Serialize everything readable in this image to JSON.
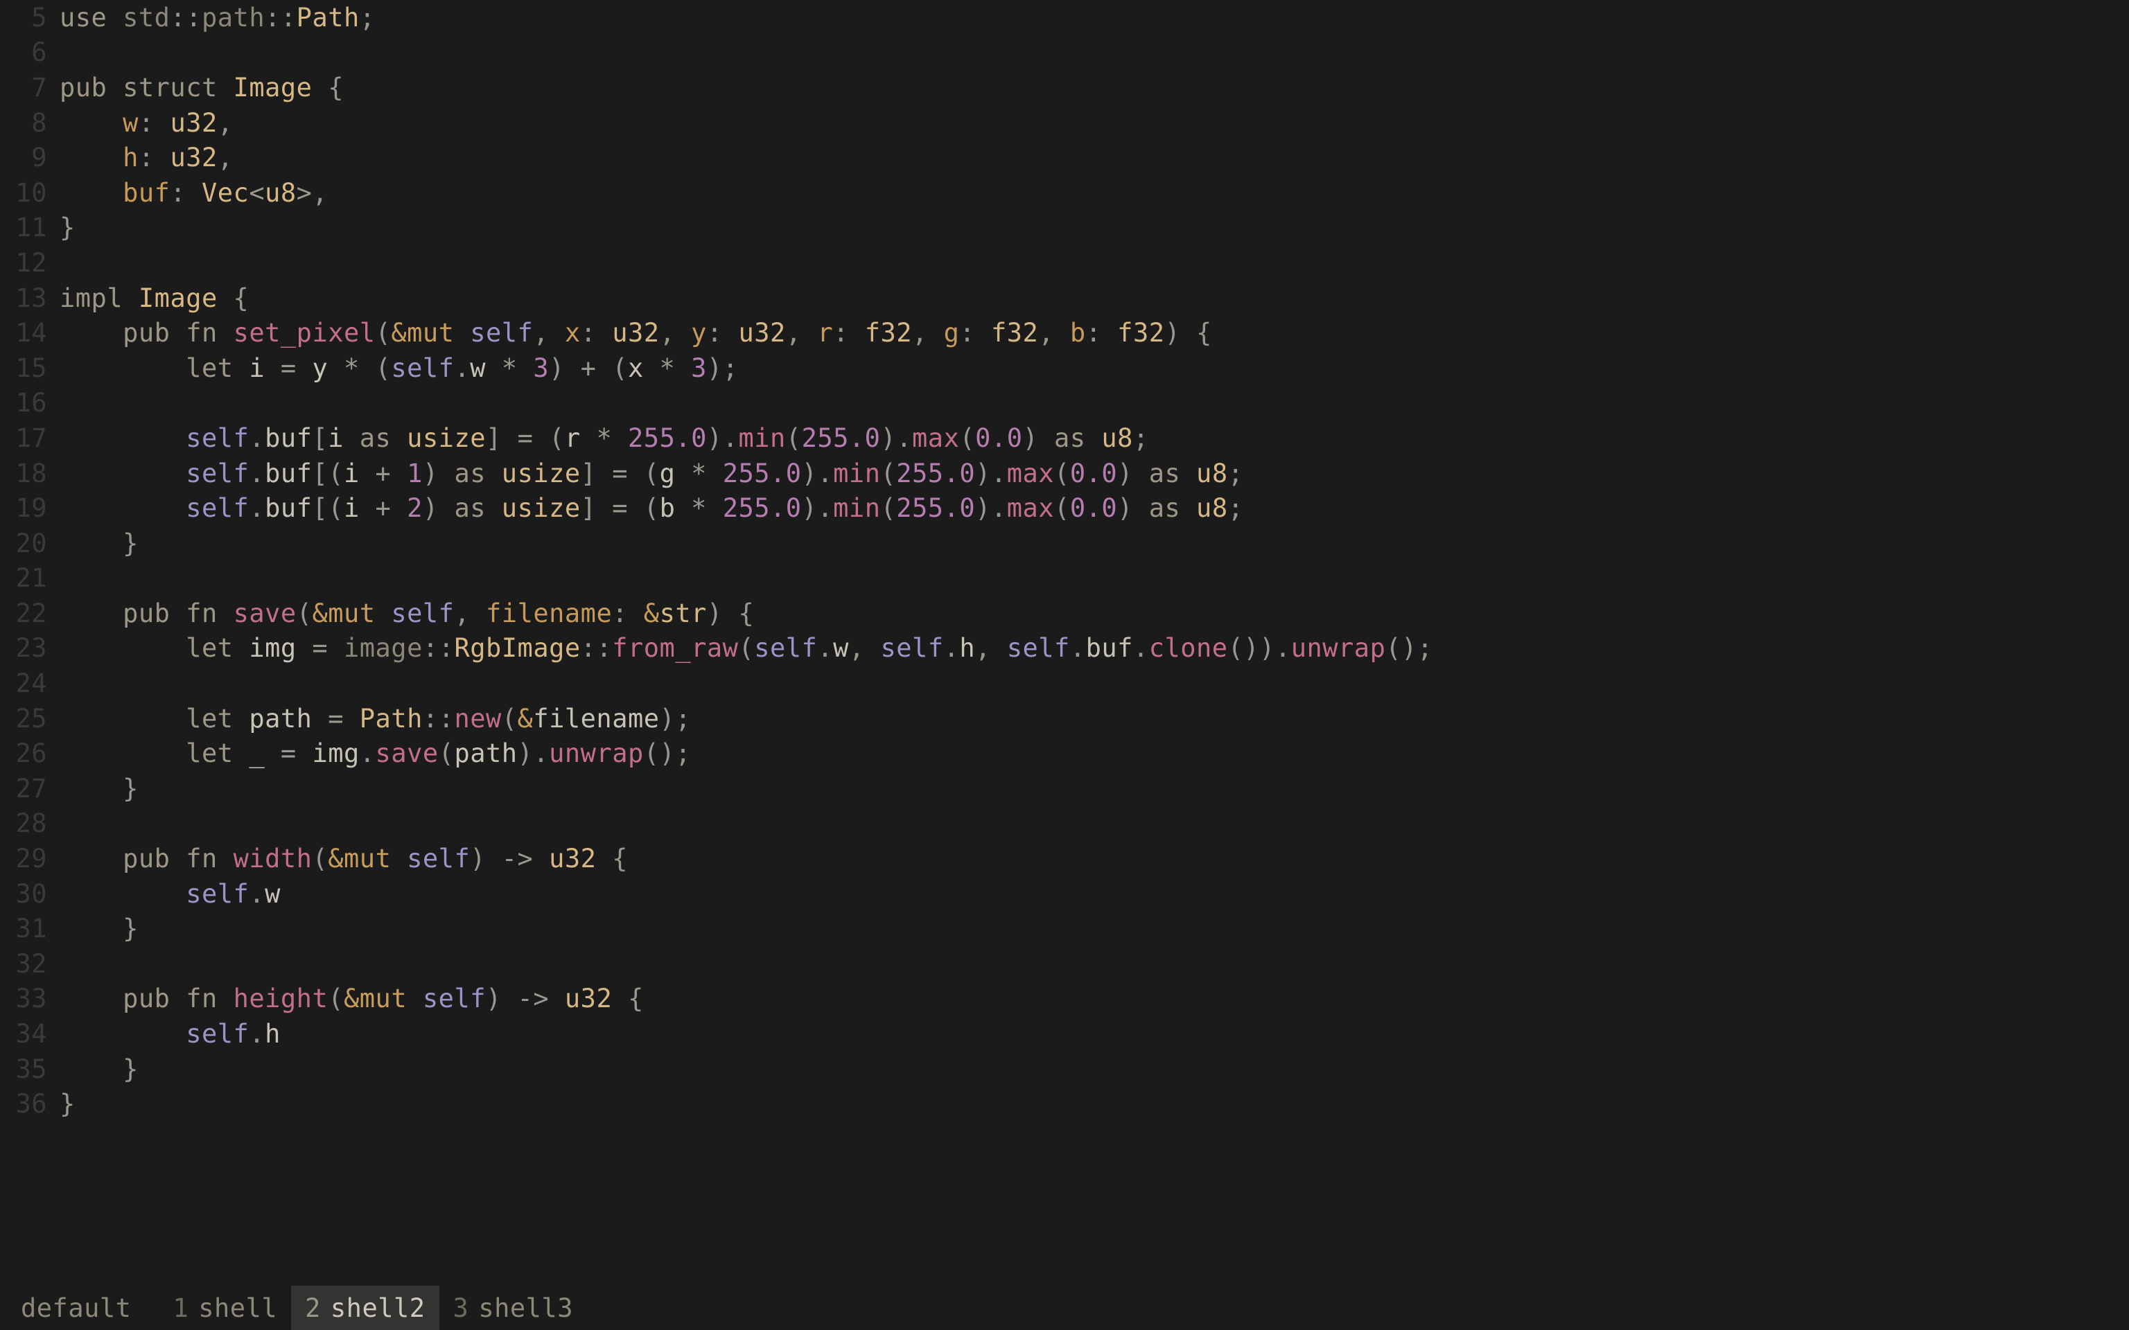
{
  "status": {
    "session": "default",
    "tabs": [
      {
        "index": "1",
        "name": "shell",
        "active": false
      },
      {
        "index": "2",
        "name": "shell2",
        "active": true
      },
      {
        "index": "3",
        "name": "shell3",
        "active": false
      }
    ]
  },
  "lines": [
    {
      "n": 5,
      "t": [
        [
          "kw",
          "use"
        ],
        [
          "punc",
          " "
        ],
        [
          "ns",
          "std"
        ],
        [
          "punc",
          "::"
        ],
        [
          "ns",
          "path"
        ],
        [
          "punc",
          "::"
        ],
        [
          "ty",
          "Path"
        ],
        [
          "punc",
          ";"
        ]
      ]
    },
    {
      "n": 6,
      "t": []
    },
    {
      "n": 7,
      "t": [
        [
          "kw",
          "pub"
        ],
        [
          "punc",
          " "
        ],
        [
          "kw",
          "struct"
        ],
        [
          "punc",
          " "
        ],
        [
          "ty",
          "Image"
        ],
        [
          "punc",
          " {"
        ]
      ]
    },
    {
      "n": 8,
      "t": [
        [
          "punc",
          "    "
        ],
        [
          "decl",
          "w"
        ],
        [
          "punc",
          ": "
        ],
        [
          "ty",
          "u32"
        ],
        [
          "punc",
          ","
        ]
      ]
    },
    {
      "n": 9,
      "t": [
        [
          "punc",
          "    "
        ],
        [
          "decl",
          "h"
        ],
        [
          "punc",
          ": "
        ],
        [
          "ty",
          "u32"
        ],
        [
          "punc",
          ","
        ]
      ]
    },
    {
      "n": 10,
      "t": [
        [
          "punc",
          "    "
        ],
        [
          "decl",
          "buf"
        ],
        [
          "punc",
          ": "
        ],
        [
          "ty",
          "Vec"
        ],
        [
          "punc",
          "<"
        ],
        [
          "ty",
          "u8"
        ],
        [
          "punc",
          ">,"
        ]
      ]
    },
    {
      "n": 11,
      "t": [
        [
          "punc",
          "}"
        ]
      ]
    },
    {
      "n": 12,
      "t": []
    },
    {
      "n": 13,
      "t": [
        [
          "kw",
          "impl"
        ],
        [
          "punc",
          " "
        ],
        [
          "ty",
          "Image"
        ],
        [
          "punc",
          " {"
        ]
      ]
    },
    {
      "n": 14,
      "t": [
        [
          "punc",
          "    "
        ],
        [
          "kw",
          "pub"
        ],
        [
          "punc",
          " "
        ],
        [
          "kw",
          "fn"
        ],
        [
          "punc",
          " "
        ],
        [
          "func",
          "set_pixel"
        ],
        [
          "punc",
          "("
        ],
        [
          "amp",
          "&"
        ],
        [
          "mutw",
          "mut"
        ],
        [
          "punc",
          " "
        ],
        [
          "mut",
          "self"
        ],
        [
          "punc",
          ", "
        ],
        [
          "decl",
          "x"
        ],
        [
          "punc",
          ": "
        ],
        [
          "ty",
          "u32"
        ],
        [
          "punc",
          ", "
        ],
        [
          "decl",
          "y"
        ],
        [
          "punc",
          ": "
        ],
        [
          "ty",
          "u32"
        ],
        [
          "punc",
          ", "
        ],
        [
          "decl",
          "r"
        ],
        [
          "punc",
          ": "
        ],
        [
          "ty",
          "f32"
        ],
        [
          "punc",
          ", "
        ],
        [
          "decl",
          "g"
        ],
        [
          "punc",
          ": "
        ],
        [
          "ty",
          "f32"
        ],
        [
          "punc",
          ", "
        ],
        [
          "decl",
          "b"
        ],
        [
          "punc",
          ": "
        ],
        [
          "ty",
          "f32"
        ],
        [
          "punc",
          ") {"
        ]
      ]
    },
    {
      "n": 15,
      "t": [
        [
          "punc",
          "        "
        ],
        [
          "kw",
          "let"
        ],
        [
          "punc",
          " "
        ],
        [
          "var",
          "i"
        ],
        [
          "punc",
          " = "
        ],
        [
          "var",
          "y"
        ],
        [
          "punc",
          " * ("
        ],
        [
          "mut",
          "self"
        ],
        [
          "punc",
          "."
        ],
        [
          "var",
          "w"
        ],
        [
          "punc",
          " * "
        ],
        [
          "num",
          "3"
        ],
        [
          "punc",
          ") + ("
        ],
        [
          "var",
          "x"
        ],
        [
          "punc",
          " * "
        ],
        [
          "num",
          "3"
        ],
        [
          "punc",
          ");"
        ]
      ]
    },
    {
      "n": 16,
      "t": []
    },
    {
      "n": 17,
      "t": [
        [
          "punc",
          "        "
        ],
        [
          "mut",
          "self"
        ],
        [
          "punc",
          "."
        ],
        [
          "var",
          "buf"
        ],
        [
          "punc",
          "["
        ],
        [
          "var",
          "i"
        ],
        [
          "punc",
          " "
        ],
        [
          "kw",
          "as"
        ],
        [
          "punc",
          " "
        ],
        [
          "ty",
          "usize"
        ],
        [
          "punc",
          "] = ("
        ],
        [
          "var",
          "r"
        ],
        [
          "punc",
          " * "
        ],
        [
          "num",
          "255.0"
        ],
        [
          "punc",
          ")."
        ],
        [
          "func",
          "min"
        ],
        [
          "punc",
          "("
        ],
        [
          "num",
          "255.0"
        ],
        [
          "punc",
          ")."
        ],
        [
          "func",
          "max"
        ],
        [
          "punc",
          "("
        ],
        [
          "num",
          "0.0"
        ],
        [
          "punc",
          ") "
        ],
        [
          "kw",
          "as"
        ],
        [
          "punc",
          " "
        ],
        [
          "ty",
          "u8"
        ],
        [
          "punc",
          ";"
        ]
      ]
    },
    {
      "n": 18,
      "t": [
        [
          "punc",
          "        "
        ],
        [
          "mut",
          "self"
        ],
        [
          "punc",
          "."
        ],
        [
          "var",
          "buf"
        ],
        [
          "punc",
          "[("
        ],
        [
          "var",
          "i"
        ],
        [
          "punc",
          " + "
        ],
        [
          "num",
          "1"
        ],
        [
          "punc",
          ") "
        ],
        [
          "kw",
          "as"
        ],
        [
          "punc",
          " "
        ],
        [
          "ty",
          "usize"
        ],
        [
          "punc",
          "] = ("
        ],
        [
          "var",
          "g"
        ],
        [
          "punc",
          " * "
        ],
        [
          "num",
          "255.0"
        ],
        [
          "punc",
          ")."
        ],
        [
          "func",
          "min"
        ],
        [
          "punc",
          "("
        ],
        [
          "num",
          "255.0"
        ],
        [
          "punc",
          ")."
        ],
        [
          "func",
          "max"
        ],
        [
          "punc",
          "("
        ],
        [
          "num",
          "0.0"
        ],
        [
          "punc",
          ") "
        ],
        [
          "kw",
          "as"
        ],
        [
          "punc",
          " "
        ],
        [
          "ty",
          "u8"
        ],
        [
          "punc",
          ";"
        ]
      ]
    },
    {
      "n": 19,
      "t": [
        [
          "punc",
          "        "
        ],
        [
          "mut",
          "self"
        ],
        [
          "punc",
          "."
        ],
        [
          "var",
          "buf"
        ],
        [
          "punc",
          "[("
        ],
        [
          "var",
          "i"
        ],
        [
          "punc",
          " + "
        ],
        [
          "num",
          "2"
        ],
        [
          "punc",
          ") "
        ],
        [
          "kw",
          "as"
        ],
        [
          "punc",
          " "
        ],
        [
          "ty",
          "usize"
        ],
        [
          "punc",
          "] = ("
        ],
        [
          "var",
          "b"
        ],
        [
          "punc",
          " * "
        ],
        [
          "num",
          "255.0"
        ],
        [
          "punc",
          ")."
        ],
        [
          "func",
          "min"
        ],
        [
          "punc",
          "("
        ],
        [
          "num",
          "255.0"
        ],
        [
          "punc",
          ")."
        ],
        [
          "func",
          "max"
        ],
        [
          "punc",
          "("
        ],
        [
          "num",
          "0.0"
        ],
        [
          "punc",
          ") "
        ],
        [
          "kw",
          "as"
        ],
        [
          "punc",
          " "
        ],
        [
          "ty",
          "u8"
        ],
        [
          "punc",
          ";"
        ]
      ]
    },
    {
      "n": 20,
      "t": [
        [
          "punc",
          "    }"
        ]
      ]
    },
    {
      "n": 21,
      "t": []
    },
    {
      "n": 22,
      "t": [
        [
          "punc",
          "    "
        ],
        [
          "kw",
          "pub"
        ],
        [
          "punc",
          " "
        ],
        [
          "kw",
          "fn"
        ],
        [
          "punc",
          " "
        ],
        [
          "func",
          "save"
        ],
        [
          "punc",
          "("
        ],
        [
          "amp",
          "&"
        ],
        [
          "mutw",
          "mut"
        ],
        [
          "punc",
          " "
        ],
        [
          "mut",
          "self"
        ],
        [
          "punc",
          ", "
        ],
        [
          "decl",
          "filename"
        ],
        [
          "punc",
          ": "
        ],
        [
          "amp",
          "&"
        ],
        [
          "ty",
          "str"
        ],
        [
          "punc",
          ") {"
        ]
      ]
    },
    {
      "n": 23,
      "t": [
        [
          "punc",
          "        "
        ],
        [
          "kw",
          "let"
        ],
        [
          "punc",
          " "
        ],
        [
          "var",
          "img"
        ],
        [
          "punc",
          " = "
        ],
        [
          "ns",
          "image"
        ],
        [
          "punc",
          "::"
        ],
        [
          "ty",
          "RgbImage"
        ],
        [
          "punc",
          "::"
        ],
        [
          "func",
          "from_raw"
        ],
        [
          "punc",
          "("
        ],
        [
          "mut",
          "self"
        ],
        [
          "punc",
          "."
        ],
        [
          "var",
          "w"
        ],
        [
          "punc",
          ", "
        ],
        [
          "mut",
          "self"
        ],
        [
          "punc",
          "."
        ],
        [
          "var",
          "h"
        ],
        [
          "punc",
          ", "
        ],
        [
          "mut",
          "self"
        ],
        [
          "punc",
          "."
        ],
        [
          "var",
          "buf"
        ],
        [
          "punc",
          "."
        ],
        [
          "func",
          "clone"
        ],
        [
          "punc",
          "())."
        ],
        [
          "func",
          "unwrap"
        ],
        [
          "punc",
          "();"
        ]
      ]
    },
    {
      "n": 24,
      "t": []
    },
    {
      "n": 25,
      "t": [
        [
          "punc",
          "        "
        ],
        [
          "kw",
          "let"
        ],
        [
          "punc",
          " "
        ],
        [
          "var",
          "path"
        ],
        [
          "punc",
          " = "
        ],
        [
          "ty",
          "Path"
        ],
        [
          "punc",
          "::"
        ],
        [
          "func",
          "new"
        ],
        [
          "punc",
          "("
        ],
        [
          "amp",
          "&"
        ],
        [
          "var",
          "filename"
        ],
        [
          "punc",
          ");"
        ]
      ]
    },
    {
      "n": 26,
      "t": [
        [
          "punc",
          "        "
        ],
        [
          "kw",
          "let"
        ],
        [
          "punc",
          " "
        ],
        [
          "var",
          "_"
        ],
        [
          "punc",
          " = "
        ],
        [
          "var",
          "img"
        ],
        [
          "punc",
          "."
        ],
        [
          "func",
          "save"
        ],
        [
          "punc",
          "("
        ],
        [
          "var",
          "path"
        ],
        [
          "punc",
          ")."
        ],
        [
          "func",
          "unwrap"
        ],
        [
          "punc",
          "();"
        ]
      ]
    },
    {
      "n": 27,
      "t": [
        [
          "punc",
          "    }"
        ]
      ]
    },
    {
      "n": 28,
      "t": []
    },
    {
      "n": 29,
      "t": [
        [
          "punc",
          "    "
        ],
        [
          "kw",
          "pub"
        ],
        [
          "punc",
          " "
        ],
        [
          "kw",
          "fn"
        ],
        [
          "punc",
          " "
        ],
        [
          "func",
          "width"
        ],
        [
          "punc",
          "("
        ],
        [
          "amp",
          "&"
        ],
        [
          "mutw",
          "mut"
        ],
        [
          "punc",
          " "
        ],
        [
          "mut",
          "self"
        ],
        [
          "punc",
          ") -> "
        ],
        [
          "ty",
          "u32"
        ],
        [
          "punc",
          " {"
        ]
      ]
    },
    {
      "n": 30,
      "t": [
        [
          "punc",
          "        "
        ],
        [
          "mut",
          "self"
        ],
        [
          "punc",
          "."
        ],
        [
          "var",
          "w"
        ]
      ]
    },
    {
      "n": 31,
      "t": [
        [
          "punc",
          "    }"
        ]
      ]
    },
    {
      "n": 32,
      "t": []
    },
    {
      "n": 33,
      "t": [
        [
          "punc",
          "    "
        ],
        [
          "kw",
          "pub"
        ],
        [
          "punc",
          " "
        ],
        [
          "kw",
          "fn"
        ],
        [
          "punc",
          " "
        ],
        [
          "func",
          "height"
        ],
        [
          "punc",
          "("
        ],
        [
          "amp",
          "&"
        ],
        [
          "mutw",
          "mut"
        ],
        [
          "punc",
          " "
        ],
        [
          "mut",
          "self"
        ],
        [
          "punc",
          ") -> "
        ],
        [
          "ty",
          "u32"
        ],
        [
          "punc",
          " {"
        ]
      ]
    },
    {
      "n": 34,
      "t": [
        [
          "punc",
          "        "
        ],
        [
          "mut",
          "self"
        ],
        [
          "punc",
          "."
        ],
        [
          "var",
          "h"
        ]
      ]
    },
    {
      "n": 35,
      "t": [
        [
          "punc",
          "    }"
        ]
      ]
    },
    {
      "n": 36,
      "t": [
        [
          "punc",
          "}"
        ]
      ]
    }
  ]
}
